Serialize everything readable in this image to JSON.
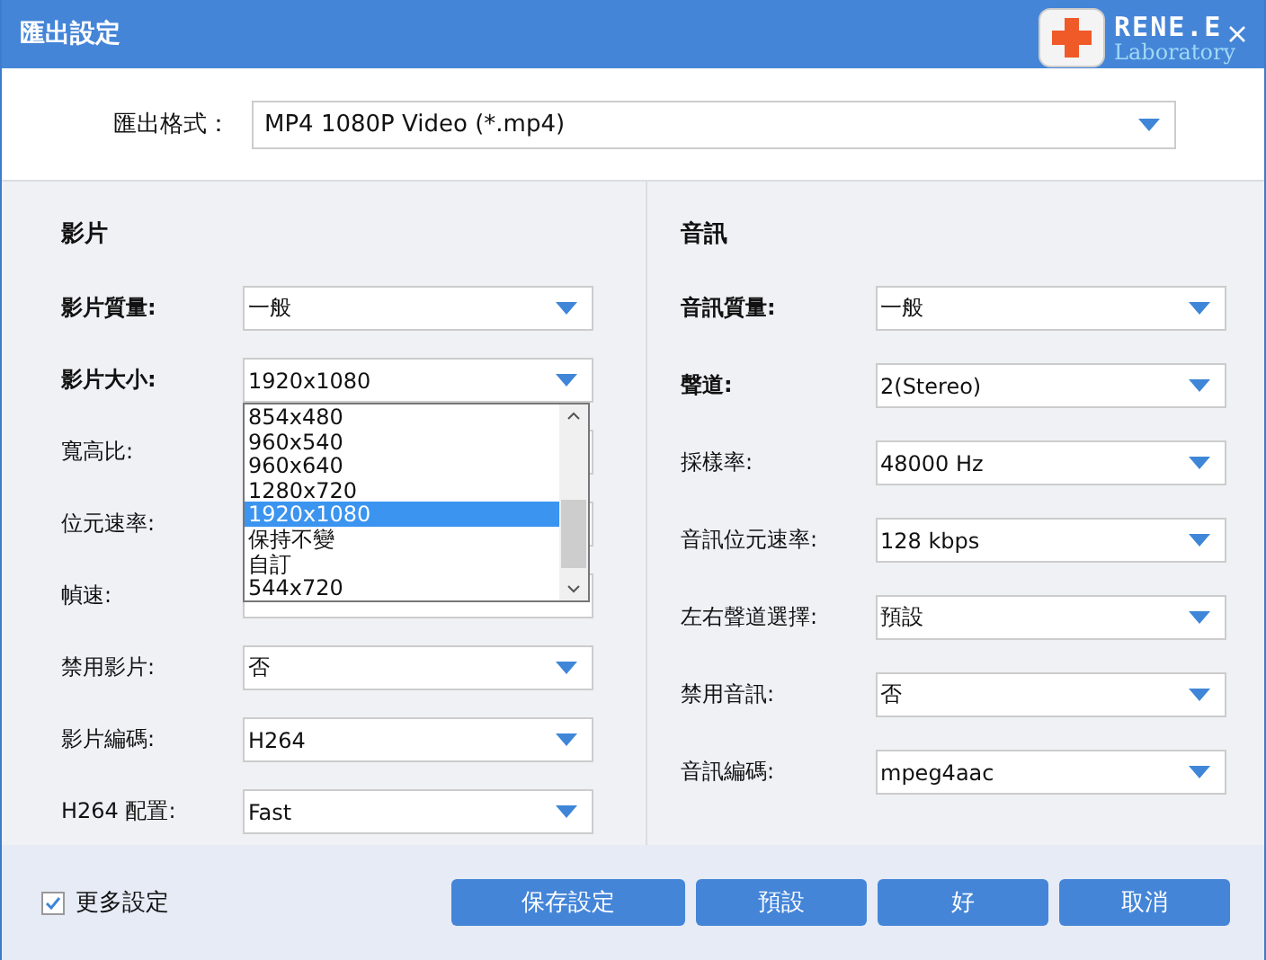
{
  "window": {
    "title": "匯出設定",
    "logo": {
      "name": "RENE.E",
      "subtitle": "Laboratory"
    }
  },
  "format": {
    "label": "匯出格式：",
    "value": "MP4 1080P Video (*.mp4)"
  },
  "video": {
    "heading": "影片",
    "fields": [
      {
        "label": "影片質量:",
        "value": "一般",
        "bold": true
      },
      {
        "label": "影片大小:",
        "value": "1920x1080",
        "bold": true,
        "options": [
          {
            "label": "854x480",
            "selected": false
          },
          {
            "label": "960x540",
            "selected": false
          },
          {
            "label": "960x640",
            "selected": false
          },
          {
            "label": "1280x720",
            "selected": false
          },
          {
            "label": "1920x1080",
            "selected": true
          },
          {
            "label": "保持不變",
            "selected": false
          },
          {
            "label": "自訂",
            "selected": false
          },
          {
            "label": "544x720",
            "selected": false
          }
        ]
      },
      {
        "label": "寬高比:",
        "bold": false
      },
      {
        "label": "位元速率:",
        "bold": false
      },
      {
        "label": "幀速:",
        "bold": false
      },
      {
        "label": "禁用影片:",
        "value": "否",
        "bold": false
      },
      {
        "label": "影片編碼:",
        "value": "H264",
        "bold": false
      },
      {
        "label": "H264 配置:",
        "value": "Fast",
        "bold": false
      }
    ]
  },
  "audio": {
    "heading": "音訊",
    "fields": [
      {
        "label": "音訊質量:",
        "value": "一般",
        "bold": true
      },
      {
        "label": "聲道:",
        "value": "2(Stereo)",
        "bold": true
      },
      {
        "label": "採樣率:",
        "value": "48000 Hz",
        "bold": false
      },
      {
        "label": "音訊位元速率:",
        "value": "128 kbps",
        "bold": false
      },
      {
        "label": "左右聲道選擇:",
        "value": "預設",
        "bold": false
      },
      {
        "label": "禁用音訊:",
        "value": "否",
        "bold": false
      },
      {
        "label": "音訊編碼:",
        "value": "mpeg4aac",
        "bold": false
      }
    ]
  },
  "footer": {
    "more": {
      "label": "更多設定",
      "checked": true
    },
    "buttons": [
      "保存設定",
      "預設",
      "好",
      "取消"
    ]
  }
}
